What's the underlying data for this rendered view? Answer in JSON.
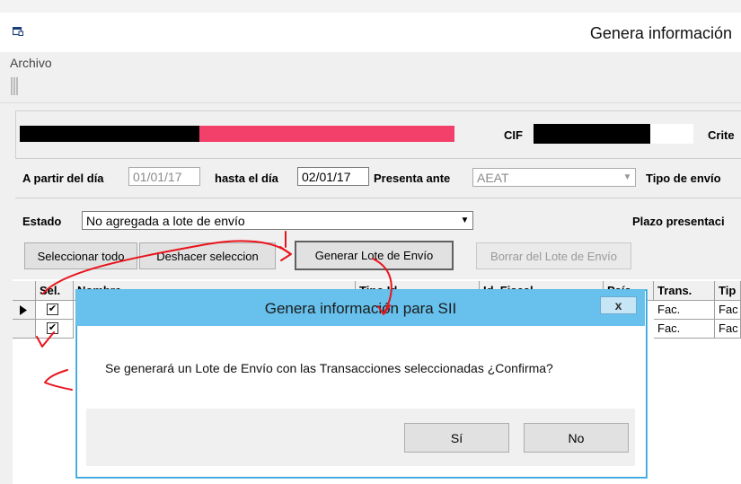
{
  "window": {
    "title": "Genera información"
  },
  "menu": {
    "file": "Archivo"
  },
  "header": {
    "cif_label": "CIF",
    "criteria_label": "Crite"
  },
  "filters": {
    "from_label": "A partir del día",
    "from_value": "01/01/17",
    "to_label": "hasta el día",
    "to_value": "02/01/17",
    "present_label": "Presenta ante",
    "present_value": "AEAT",
    "send_type_label": "Tipo de envío",
    "state_label": "Estado",
    "state_value": "No agregada a lote de envío",
    "deadline_label": "Plazo presentaci"
  },
  "buttons": {
    "select_all": "Seleccionar todo",
    "undo_select": "Deshacer seleccion",
    "generate_batch": "Generar Lote de Envío",
    "delete_batch": "Borrar del Lote de Envío"
  },
  "grid": {
    "headers": [
      "Sel.",
      "Nombre",
      "Tipo Id",
      "Id. Fiscal",
      "País",
      "Trans.",
      "Tip"
    ],
    "rows": [
      {
        "trans": "Fac.",
        "tip": "Fac"
      },
      {
        "trans": "Fac.",
        "tip": "Fac"
      }
    ]
  },
  "dialog": {
    "title": "Genera información para SII",
    "close": "x",
    "message": "Se generará un Lote de Envío con las Transacciones seleccionadas ¿Confirma?",
    "yes": "Sí",
    "no": "No"
  },
  "colors": {
    "accent": "#67c1ec",
    "highlight_bar": "#f2406a",
    "annotation": "#e8141c"
  }
}
